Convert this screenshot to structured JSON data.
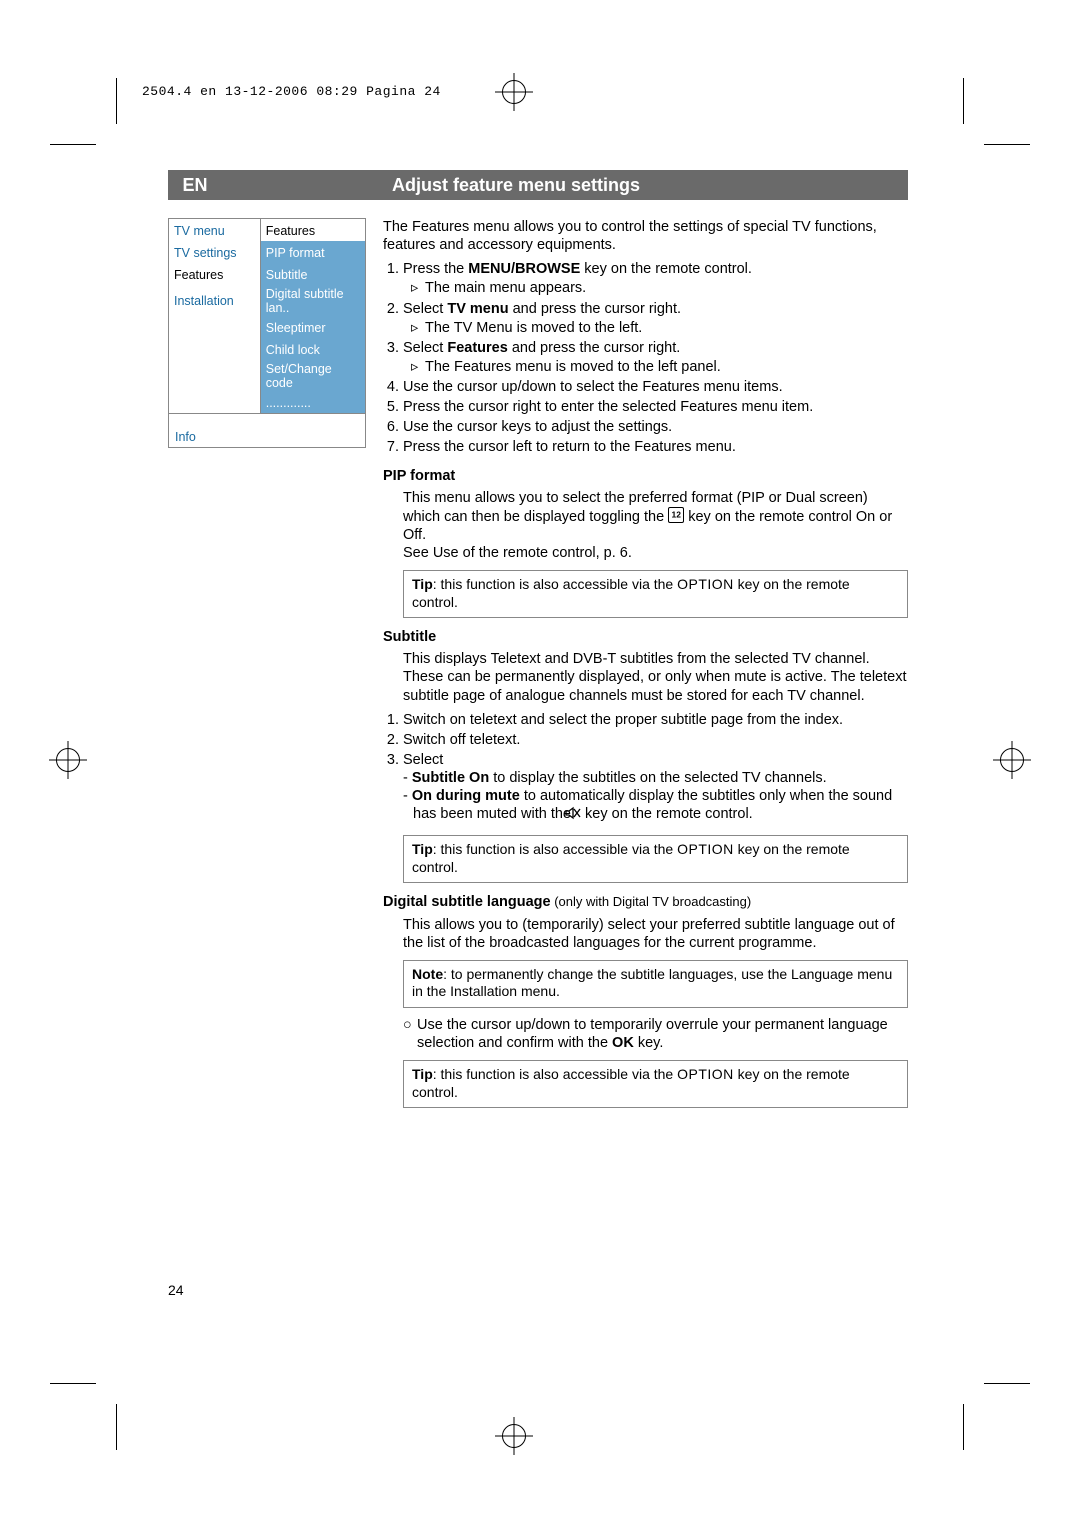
{
  "print_header": "2504.4 en  13-12-2006  08:29  Pagina 24",
  "lang_tag": "EN",
  "title": "Adjust feature menu settings",
  "page_number": "24",
  "menu": {
    "left_header": "TV menu",
    "right_header": "Features",
    "left": [
      "TV settings",
      "Features",
      "Installation",
      "",
      "",
      ""
    ],
    "left_active_index": 1,
    "right": [
      "PIP format",
      "Subtitle",
      "Digital subtitle lan..",
      "Sleeptimer",
      "Child lock",
      "Set/Change code",
      "............."
    ],
    "info": "Info"
  },
  "intro": "The Features menu allows you to control the settings of special TV functions, features and accessory equipments.",
  "steps": [
    {
      "text_before": "Press the ",
      "bold": "MENU/BROWSE",
      "text_after": " key on the remote control.",
      "result": "The main menu appears."
    },
    {
      "text_before": "Select ",
      "bold": "TV menu",
      "text_after": " and press the cursor right.",
      "result": "The TV Menu is moved to the left."
    },
    {
      "text_before": "Select ",
      "bold": "Features",
      "text_after": " and press the cursor right.",
      "result": "The Features menu is moved to the left panel."
    },
    {
      "text_plain": "Use the cursor up/down to select the Features menu items."
    },
    {
      "text_plain": "Press the cursor right to enter the selected Features menu item."
    },
    {
      "text_plain": "Use the cursor keys to adjust the settings."
    },
    {
      "text_plain": "Press the cursor left to return to the Features menu."
    }
  ],
  "pip": {
    "heading": "PIP format",
    "p1a": "This menu allows you to select the preferred format (PIP or Dual screen) which can then be displayed toggling the ",
    "p1b": " key on the remote control On or Off.",
    "p2": "See Use of the remote control, p. 6.",
    "tip_before": "Tip",
    "tip_mid": ": this function is also accessible via the ",
    "tip_key": "OPTION",
    "tip_after": " key on the remote control."
  },
  "subtitle": {
    "heading": "Subtitle",
    "p1": "This displays Teletext and DVB-T subtitles from the selected TV channel. These can be permanently displayed, or only when mute is active. The teletext subtitle page of analogue channels must be stored for each TV channel.",
    "s1": "Switch on teletext and select the proper subtitle page from the index.",
    "s2": "Switch off teletext.",
    "s3": "Select",
    "d1a": "Subtitle On",
    "d1b": " to display the subtitles on the selected TV channels.",
    "d2a": "On during mute",
    "d2b_before": " to automatically display the subtitles only when the sound has been muted with the ",
    "d2b_after": " key on the remote control.",
    "tip_before": "Tip",
    "tip_mid": ": this function is also accessible via the ",
    "tip_key": "OPTION",
    "tip_after": " key on the remote control."
  },
  "dsl": {
    "heading": "Digital subtitle language",
    "heading_note": " (only with Digital TV broadcasting)",
    "p1": "This allows you to (temporarily) select your preferred subtitle language out of the list of the broadcasted languages for the current programme.",
    "note_before": "Note",
    "note_after": ": to permanently change the subtitle languages, use the Language menu in the Installation menu.",
    "b1_before": "Use the cursor up/down to temporarily overrule your permanent language selection and confirm with the ",
    "b1_bold": "OK",
    "b1_after": " key.",
    "tip_before": "Tip",
    "tip_mid": ": this function is also accessible via the ",
    "tip_key": "OPTION",
    "tip_after": " key on the remote control."
  }
}
